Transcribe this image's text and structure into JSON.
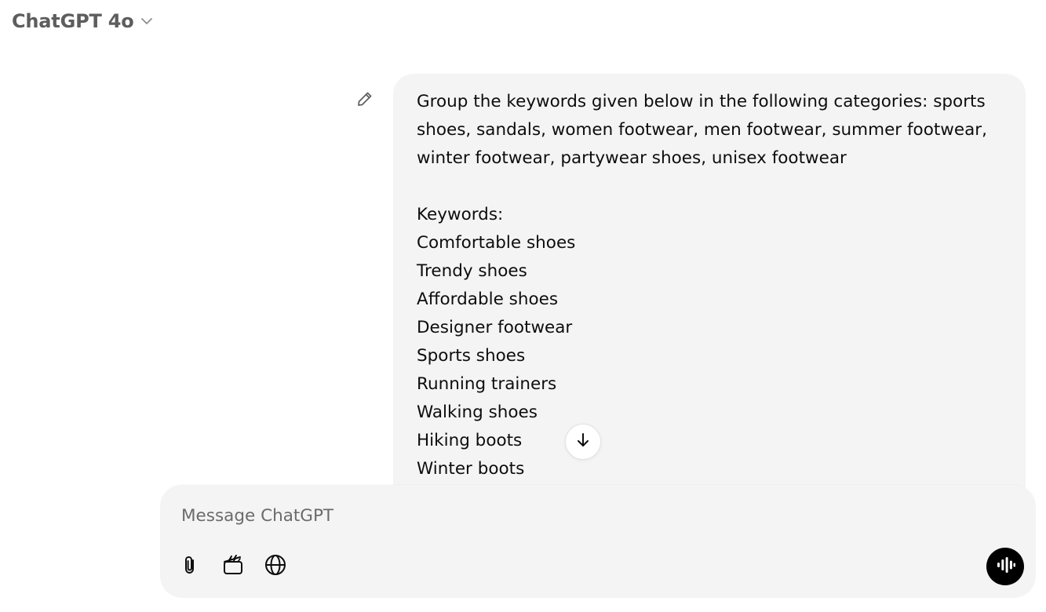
{
  "header": {
    "model_name": "ChatGPT 4o",
    "model_dropdown_icon": "chevron-down-icon"
  },
  "user_message": {
    "edit_icon": "pencil-icon",
    "prompt_line_1": "Group the keywords given below in the following categories: sports",
    "prompt_line_2": "shoes, sandals, women footwear, men footwear, summer footwear,",
    "prompt_line_3": "winter footwear, partywear shoes, unisex footwear",
    "keywords_heading": "Keywords:",
    "keywords": [
      "Comfortable shoes",
      "Trendy shoes",
      "Affordable shoes",
      "Designer footwear",
      "Sports shoes",
      "Running trainers",
      "Walking shoes",
      "Hiking boots",
      "Winter boots"
    ]
  },
  "scroll_button": {
    "icon": "arrow-down-icon"
  },
  "composer": {
    "placeholder": "Message ChatGPT",
    "value": "",
    "tools": [
      {
        "icon": "paperclip-icon"
      },
      {
        "icon": "clapperboard-icon"
      },
      {
        "icon": "globe-icon"
      }
    ],
    "voice_icon": "voice-waveform-icon"
  },
  "colors": {
    "bubble_bg": "#f4f4f4",
    "composer_bg": "#f4f4f4",
    "text": "#0d0d0d",
    "muted": "#5d5d5d",
    "voice_button_bg": "#000000"
  }
}
